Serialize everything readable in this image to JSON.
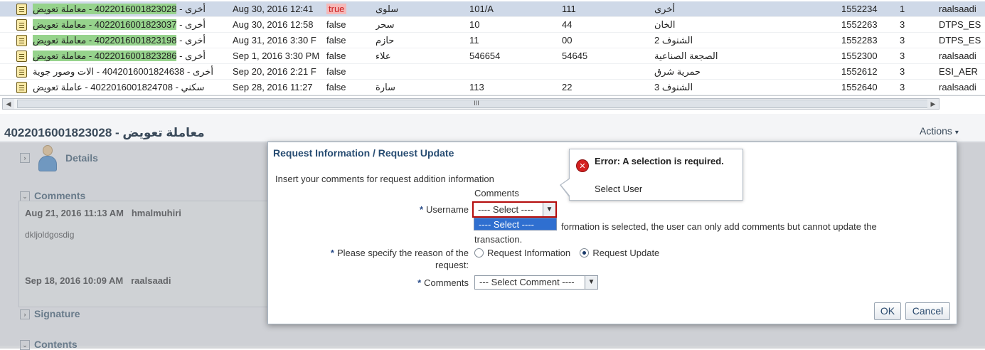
{
  "table": {
    "rows": [
      {
        "title_ar": "أخرى",
        "number": "4022016001823028",
        "title_ar2": "معاملة تعويض",
        "date": "Aug 30, 2016 12:41",
        "flag": "true",
        "name": "سلوى",
        "col_a": "101/A",
        "col_b": "111",
        "area": "أخرى",
        "id": "1552234",
        "n": "1",
        "user": "raalsaadi",
        "highlight": true,
        "selected": true
      },
      {
        "title_ar": "أخرى",
        "number": "4022016001823037",
        "title_ar2": "معاملة تعويض",
        "date": "Aug 30, 2016 12:58",
        "flag": "false",
        "name": "سحر",
        "col_a": "10",
        "col_b": "44",
        "area": "الخان",
        "id": "1552263",
        "n": "3",
        "user": "DTPS_ES",
        "highlight": true,
        "selected": false
      },
      {
        "title_ar": "أخرى",
        "number": "4022016001823198",
        "title_ar2": "معاملة تعويض",
        "date": "Aug 31, 2016 3:30 F",
        "flag": "false",
        "name": "حازم",
        "col_a": "11",
        "col_b": "00",
        "area": "الشنوف 2",
        "id": "1552283",
        "n": "3",
        "user": "DTPS_ES",
        "highlight": true,
        "selected": false
      },
      {
        "title_ar": "أخرى",
        "number": "4022016001823286",
        "title_ar2": "معاملة تعويض",
        "date": "Sep 1, 2016 3:30 PM",
        "flag": "false",
        "name": "علاء",
        "col_a": "546654",
        "col_b": "54645",
        "area": "الصجعة الصناعية",
        "id": "1552300",
        "n": "3",
        "user": "raalsaadi",
        "highlight": true,
        "selected": false
      },
      {
        "title_ar": "أخرى",
        "number": "4042016001824638",
        "title_ar2": "الات وصور جوية",
        "date": "Sep 20, 2016 2:21 F",
        "flag": "false",
        "name": "",
        "col_a": "",
        "col_b": "",
        "area": "حمرية شرق",
        "id": "1552612",
        "n": "3",
        "user": "ESI_AER",
        "highlight": false,
        "selected": false
      },
      {
        "title_ar": "سكني",
        "number": "4022016001824708",
        "title_ar2": "عاملة تعويض",
        "date": "Sep 28, 2016 11:27",
        "flag": "false",
        "name": "سارة",
        "col_a": "113",
        "col_b": "22",
        "area": "الشنوف 3",
        "id": "1552640",
        "n": "3",
        "user": "raalsaadi",
        "highlight": false,
        "selected": false
      }
    ],
    "scroll_grip": "III"
  },
  "panel": {
    "title": "4022016001823028 - معاملة تعويض",
    "actions_label": "Actions",
    "details_label": "Details",
    "comments_label": "Comments",
    "signature_label": "Signature",
    "contents_label": "Contents",
    "comments": [
      {
        "date": "Aug 21, 2016 11:13 AM",
        "user": "hmalmuhiri",
        "text": "dkljoldgosdig"
      },
      {
        "date": "Sep 18, 2016 10:09 AM",
        "user": "raalsaadi",
        "text": ""
      }
    ]
  },
  "dialog": {
    "title": "Request Information / Request Update",
    "subtitle": "Insert your comments for request addition information",
    "comments_caption": "Comments",
    "username_label": "Username",
    "username_value": "---- Select ----",
    "dropdown_option": "---- Select ----",
    "info_line1": "formation is selected, the user can only add comments but cannot update the",
    "info_line2": "transaction.",
    "reason_label_1": "Please specify the reason of the",
    "reason_label_2": "request:",
    "radio_info": "Request Information",
    "radio_update": "Request Update",
    "comments_label": "Comments",
    "comments_value": "--- Select Comment ----",
    "ok_label": "OK",
    "cancel_label": "Cancel"
  },
  "error": {
    "title": "Error: A selection is required.",
    "message": "Select User",
    "icon": "error-icon"
  },
  "colors": {
    "highlight": "#96d38c",
    "selected_row": "#cfd9e8",
    "error_red": "#b40b0b",
    "accent_blue": "#274c72"
  }
}
